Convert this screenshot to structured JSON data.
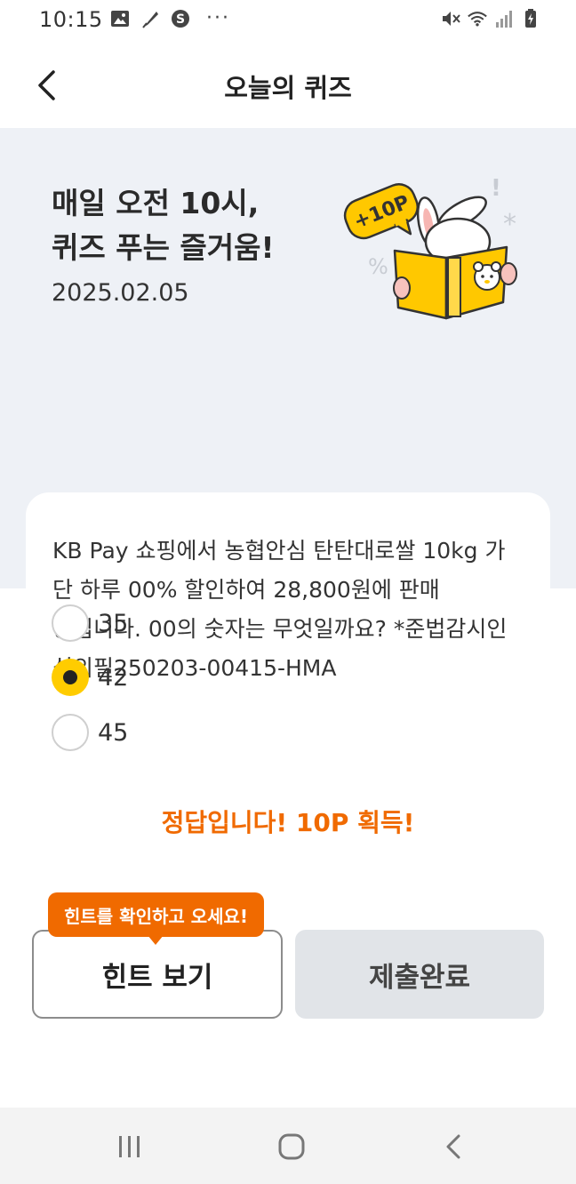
{
  "status_bar": {
    "time": "10:15",
    "more": "···",
    "left_icons": [
      "gallery-icon",
      "feather-icon",
      "s-coin-icon"
    ],
    "right_icons": [
      "mute-icon",
      "wifi-icon",
      "signal-icon",
      "battery-icon"
    ]
  },
  "header": {
    "title": "오늘의 퀴즈",
    "back_icon": "chevron-left-icon"
  },
  "hero": {
    "headline_line1": "매일 오전 10시,",
    "headline_line2": "퀴즈 푸는 즐거움!",
    "date": "2025.02.05",
    "badge_text": "+10P"
  },
  "question": {
    "text": "KB Pay 쇼핑에서 농협안심 탄탄대로쌀 10kg 가 단 하루 00% 할인하여 28,800원에 판매 중입니다. 00의 숫자는 무엇일까요? *준법감시인 심의필250203-00415-HMA"
  },
  "options": [
    {
      "label": "35",
      "selected": false
    },
    {
      "label": "42",
      "selected": true
    },
    {
      "label": "45",
      "selected": false
    }
  ],
  "result": "정답입니다! 10P 획득!",
  "buttons": {
    "hint_tooltip": "힌트를 확인하고 오세요!",
    "hint": "힌트 보기",
    "submit": "제출완료"
  },
  "nav": {
    "icons": [
      "recent-apps-icon",
      "home-icon",
      "back-icon"
    ]
  },
  "colors": {
    "accent": "#f06a00",
    "selected": "#ffcc00",
    "hero_bg": "#eef1f6"
  }
}
